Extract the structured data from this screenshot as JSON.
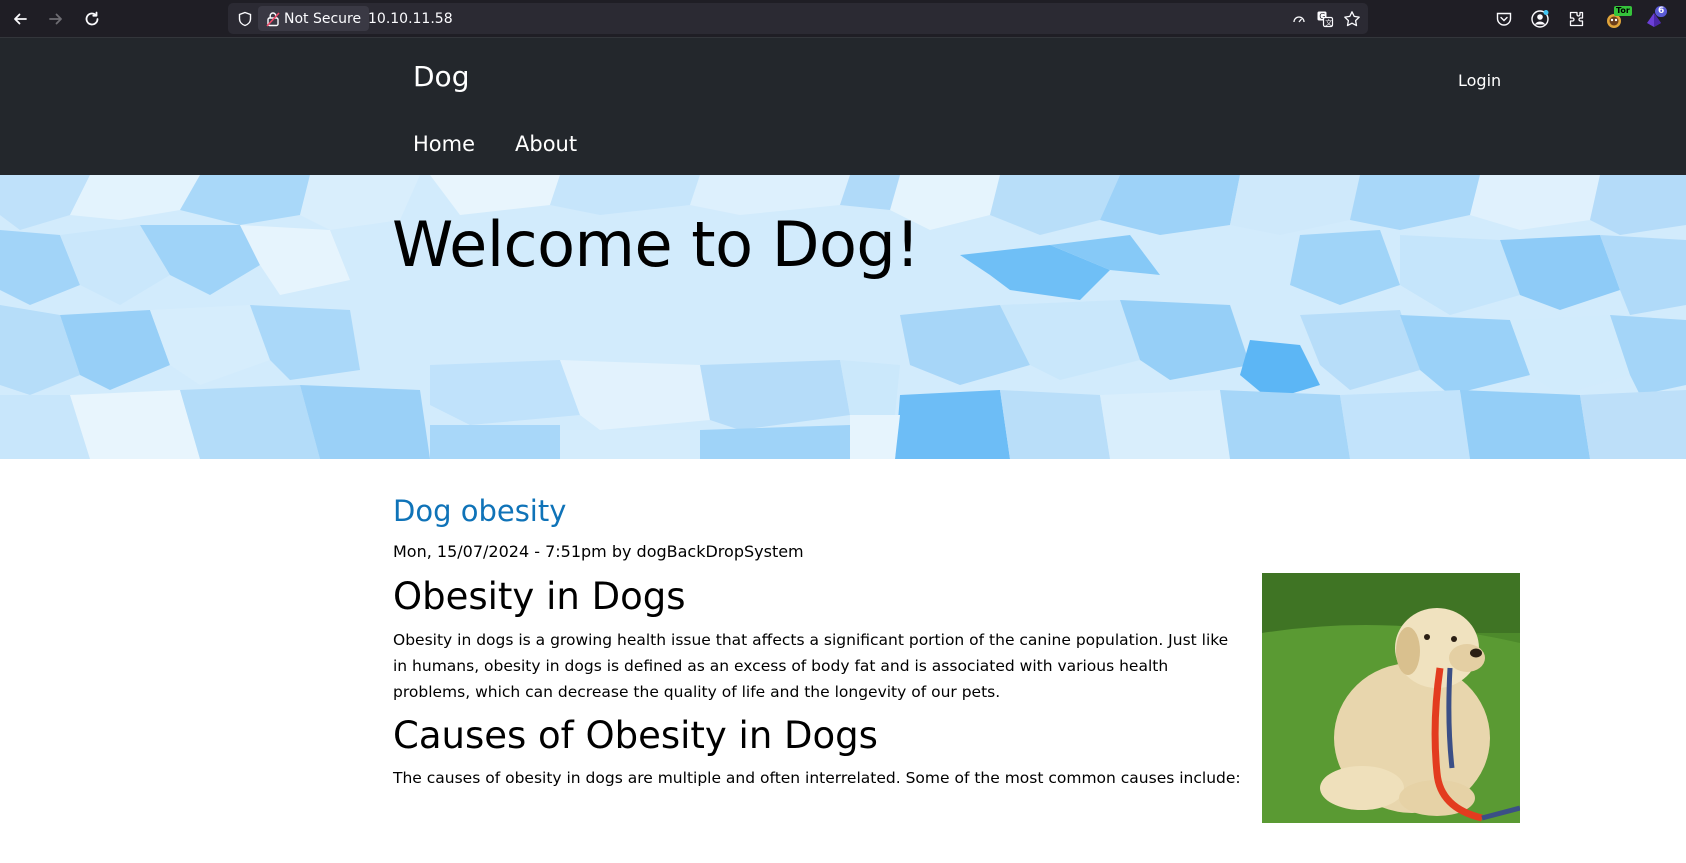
{
  "browser": {
    "security_label": "Not Secure",
    "url": "10.10.11.58",
    "tor_badge": "Tor",
    "extensions_count": "6"
  },
  "site": {
    "name": "Dog",
    "login": "Login",
    "menu": [
      "Home",
      "About"
    ]
  },
  "hero": {
    "title": "Welcome to Dog!"
  },
  "article": {
    "title": "Dog obesity",
    "meta": "Mon, 15/07/2024 - 7:51pm by dogBackDropSystem",
    "sections": [
      {
        "heading": "Obesity in Dogs",
        "text": "Obesity in dogs is a growing health issue that affects a significant portion of the canine population. Just like in humans, obesity in dogs is defined as an excess of body fat and is associated with various health problems, which can decrease the quality of life and the longevity of our pets."
      },
      {
        "heading": "Causes of Obesity in Dogs",
        "text": "The causes of obesity in dogs are multiple and often interrelated. Some of the most common causes include:"
      }
    ]
  },
  "colors": {
    "header_bg": "#23272c",
    "link_blue": "#0f73b8",
    "hero_base": "#cfe8fb"
  }
}
